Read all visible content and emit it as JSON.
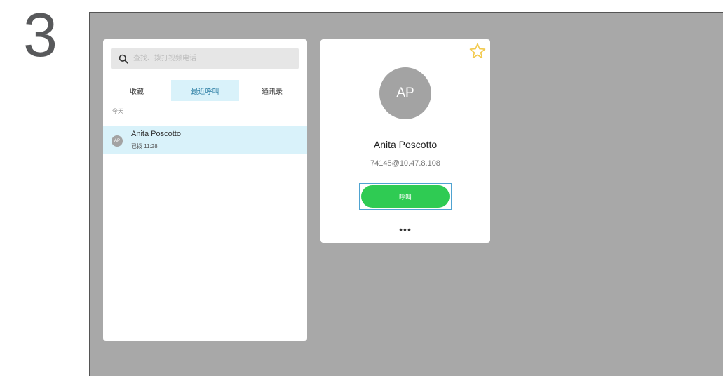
{
  "step": "3",
  "search": {
    "placeholder": "查找、拨打视频电话",
    "icon": "search-icon"
  },
  "tabs": [
    {
      "label": "收藏"
    },
    {
      "label": "最近呼叫",
      "active": true
    },
    {
      "label": "通讯录"
    }
  ],
  "recent": {
    "section_label": "今天",
    "items": [
      {
        "avatar_initials": "AP",
        "name": "Anita Poscotto",
        "detail": "已拨 11:28"
      }
    ]
  },
  "contact": {
    "initials": "AP",
    "name": "Anita Poscotto",
    "address": "74145@10.47.8.108",
    "call_label": "呼叫",
    "more_label": "•••",
    "favorite_icon": "star-outline-icon"
  },
  "colors": {
    "screen_bg": "#a8a8a8",
    "selected_bg": "#d9f2fa",
    "call_green": "#2fcb53",
    "star_yellow": "#f2c94c",
    "avatar_gray": "#a3a3a3",
    "focus_blue": "#4fa3d1"
  }
}
